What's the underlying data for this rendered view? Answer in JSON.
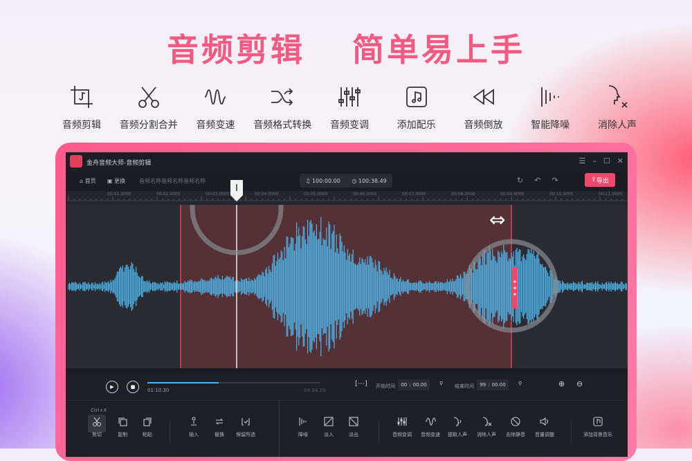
{
  "headline": {
    "part1": "音频剪辑",
    "part2": "简单易上手"
  },
  "features": [
    {
      "label": "音频剪辑",
      "icon": "crop-music-icon"
    },
    {
      "label": "音频分割合并",
      "icon": "scissors-icon"
    },
    {
      "label": "音频变速",
      "icon": "wave-speed-icon"
    },
    {
      "label": "音频格式转换",
      "icon": "shuffle-icon"
    },
    {
      "label": "音频变调",
      "icon": "sliders-icon"
    },
    {
      "label": "添加配乐",
      "icon": "music-note-icon"
    },
    {
      "label": "音频倒放",
      "icon": "rewind-icon"
    },
    {
      "label": "智能降噪",
      "icon": "noise-reduce-icon"
    },
    {
      "label": "消除人声",
      "icon": "remove-voice-icon"
    }
  ],
  "app": {
    "title": "金舟音频大师-音频剪辑",
    "toolbar": {
      "home": "首页",
      "replace": "更换",
      "filename": "音频名称音频名称音频名称",
      "time_current": "100:00.00",
      "time_total": "100:38.49",
      "export": "导出"
    },
    "ruler_ticks": [
      "00:01.0000",
      "00:02.0000",
      "00:03.0000",
      "00:04.0000",
      "00:05.0000",
      "00:06.0000",
      "00:07.0000",
      "00:08.0000",
      "00:09.0000",
      "00:10.0000",
      "00:11.0000"
    ],
    "player": {
      "elapsed": "01:10.30",
      "total": "04:34.10",
      "progress": 0.41,
      "start_label": "开始时间",
      "start_h": "00",
      "start_m": "00.00",
      "end_label": "结束时间",
      "end_h": "99",
      "end_m": "00.00"
    },
    "bottom_tools": [
      {
        "label": "剪切",
        "hint": "Ctrl+X",
        "icon": "scissors-icon"
      },
      {
        "label": "复制",
        "icon": "copy-icon"
      },
      {
        "label": "粘贴",
        "icon": "paste-icon"
      },
      {
        "label": "插入",
        "icon": "insert-icon"
      },
      {
        "label": "替换",
        "icon": "replace-icon"
      },
      {
        "label": "保留所选",
        "icon": "keep-selection-icon"
      },
      {
        "label": "降噪",
        "icon": "noise-reduce-icon"
      },
      {
        "label": "淡入",
        "icon": "fade-in-icon"
      },
      {
        "label": "淡出",
        "icon": "fade-out-icon"
      },
      {
        "label": "音频变调",
        "icon": "sliders-icon"
      },
      {
        "label": "音频变速",
        "icon": "wave-speed-icon"
      },
      {
        "label": "提取人声",
        "icon": "extract-voice-icon"
      },
      {
        "label": "消除人声",
        "icon": "remove-voice-icon"
      },
      {
        "label": "去除静音",
        "icon": "mute-icon"
      },
      {
        "label": "音量调整",
        "icon": "volume-icon"
      },
      {
        "label": "添加背景音乐",
        "icon": "music-note-icon"
      }
    ]
  },
  "colors": {
    "accent": "#f0486c",
    "headline": "#f25a86",
    "waveform": "#4fb3e8",
    "selection": "#5a3238"
  }
}
